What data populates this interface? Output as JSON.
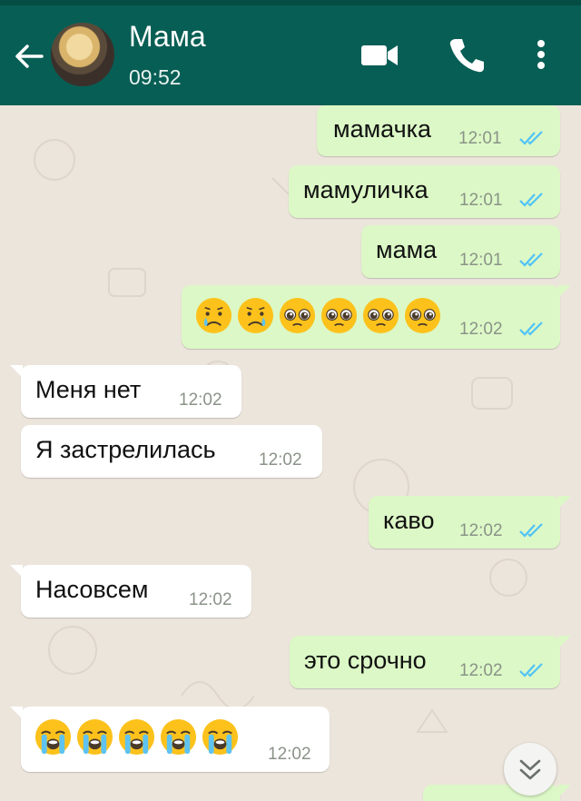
{
  "header": {
    "contact_name": "Мама",
    "last_seen": "09:52"
  },
  "messages": [
    {
      "direction": "out",
      "text": "мамачка",
      "time": "12:01",
      "read": true
    },
    {
      "direction": "out",
      "text": "мамуличка",
      "time": "12:01",
      "read": true
    },
    {
      "direction": "out",
      "text": "мама",
      "time": "12:01",
      "read": true
    },
    {
      "direction": "out",
      "emojis": [
        "crying-face",
        "sad-tear-face",
        "pleading-face",
        "pleading-face",
        "pleading-face",
        "pleading-face"
      ],
      "time": "12:02",
      "read": true
    },
    {
      "direction": "in",
      "text": "Меня нет",
      "time": "12:02"
    },
    {
      "direction": "in",
      "text": "Я застрелилась",
      "time": "12:02"
    },
    {
      "direction": "out",
      "text": "каво",
      "time": "12:02",
      "read": true
    },
    {
      "direction": "in",
      "text": "Насовсем",
      "time": "12:02"
    },
    {
      "direction": "out",
      "text": "это срочно",
      "time": "12:02",
      "read": true
    },
    {
      "direction": "in",
      "emojis": [
        "loudly-crying-face",
        "loudly-crying-face",
        "loudly-crying-face",
        "loudly-crying-face",
        "loudly-crying-face"
      ],
      "time": "12:02"
    }
  ],
  "colors": {
    "header": "#075e54",
    "outgoing_bubble": "#dcf8c6",
    "incoming_bubble": "#ffffff",
    "read_ticks": "#4fc3f7",
    "chat_background": "#ece5dc"
  },
  "icons": [
    "back-arrow-icon",
    "video-call-icon",
    "phone-icon",
    "more-vert-icon",
    "double-check-icon",
    "scroll-down-icon"
  ]
}
